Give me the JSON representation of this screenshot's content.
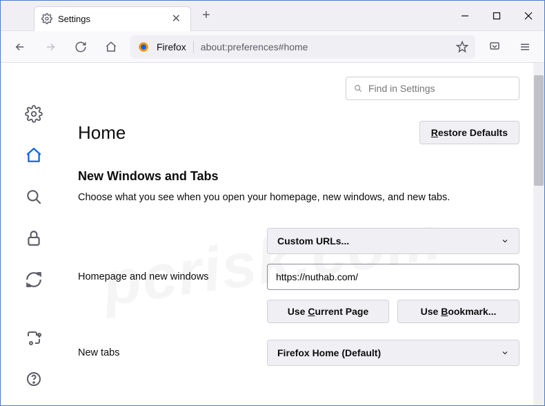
{
  "tab": {
    "title": "Settings"
  },
  "url": {
    "identity": "Firefox",
    "path": "about:preferences#home"
  },
  "search": {
    "placeholder": "Find in Settings"
  },
  "page": {
    "heading": "Home",
    "restore": "Restore Defaults",
    "section_title": "New Windows and Tabs",
    "section_desc": "Choose what you see when you open your homepage, new windows, and new tabs."
  },
  "homepage": {
    "label": "Homepage and new windows",
    "dropdown": "Custom URLs...",
    "value": "https://nuthab.com/",
    "use_current": "Use Current Page",
    "use_bookmark": "Use Bookmark..."
  },
  "newtabs": {
    "label": "New tabs",
    "dropdown": "Firefox Home (Default)"
  }
}
